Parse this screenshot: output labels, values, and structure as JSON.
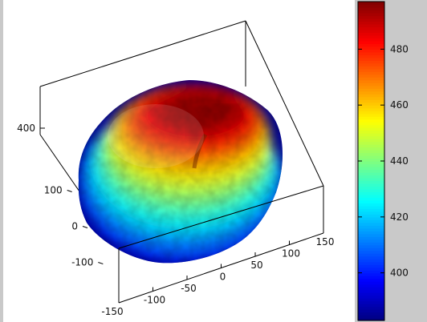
{
  "chart_data": {
    "type": "surface",
    "colormap": "jet",
    "x_ticks": [
      -150,
      -100,
      -50,
      0,
      50,
      100,
      150
    ],
    "y_ticks": [
      -100,
      0,
      100
    ],
    "z_ticks": [
      400
    ],
    "colorbar": {
      "range": [
        383,
        497
      ],
      "ticks": [
        400,
        420,
        440,
        460,
        480
      ]
    },
    "surface_value_range": [
      385,
      495
    ]
  },
  "colors": {
    "background": "#c9c9c9",
    "plot_background": "#ffffff",
    "box_lines": "#000000"
  }
}
